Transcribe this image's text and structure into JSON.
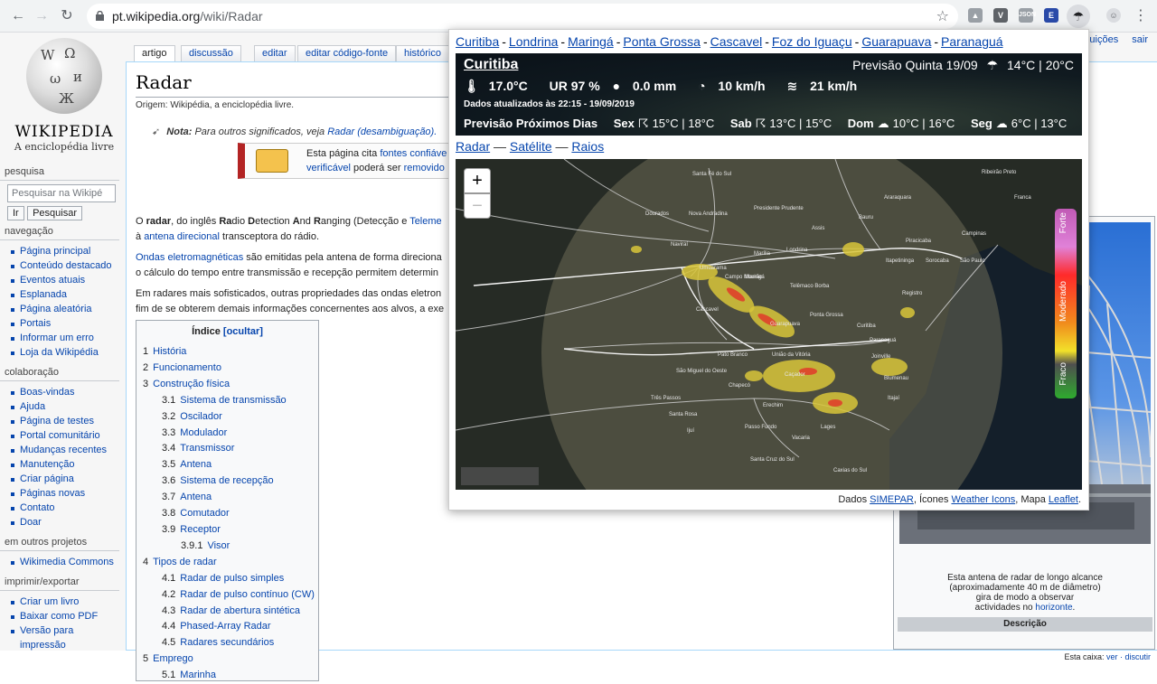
{
  "browser": {
    "url_host": "pt.wikipedia.org",
    "url_path": "/wiki/Radar"
  },
  "wiki": {
    "logo_wordmark": "WIKIPEDIA",
    "logo_tagline": "A enciclopédia livre",
    "tabs": [
      "artigo",
      "discussão",
      "editar",
      "editar código-fonte",
      "histórico"
    ],
    "personal_links": [
      "uições",
      "sair"
    ],
    "title": "Radar",
    "site_sub": "Origem: Wikipédia, a enciclopédia livre.",
    "hatnote_prefix": "Nota:",
    "hatnote_text": "Para outros significados, veja",
    "hatnote_link": "Radar (desambiguação).",
    "ambox_line1_text": "Esta página cita",
    "ambox_line1_link": "fontes confiáve",
    "ambox_line2_link": "verificável",
    "ambox_line2_text": "poderá ser",
    "ambox_line2_link2": "removido",
    "search": {
      "heading": "pesquisa",
      "placeholder": "Pesquisar na Wikipé",
      "go": "Ir",
      "search": "Pesquisar"
    },
    "navigation": {
      "heading": "navegação",
      "items": [
        "Página principal",
        "Conteúdo destacado",
        "Eventos atuais",
        "Esplanada",
        "Página aleatória",
        "Portais",
        "Informar um erro",
        "Loja da Wikipédia"
      ]
    },
    "collaboration": {
      "heading": "colaboração",
      "items": [
        "Boas-vindas",
        "Ajuda",
        "Página de testes",
        "Portal comunitário",
        "Mudanças recentes",
        "Manutenção",
        "Criar página",
        "Páginas novas",
        "Contato",
        "Doar"
      ]
    },
    "other_projects": {
      "heading": "em outros projetos",
      "items": [
        "Wikimedia Commons"
      ]
    },
    "print_export": {
      "heading": "imprimir/exportar",
      "items": [
        "Criar um livro",
        "Baixar como PDF",
        "Versão para",
        "impressão"
      ]
    },
    "paragraphs": [
      {
        "pre": "O ",
        "b1": "radar",
        "t1": ", do inglês ",
        "b2": "Ra",
        "t2": "dio ",
        "b3": "D",
        "t3": "etection ",
        "b4": "A",
        "t4": "nd ",
        "b5": "R",
        "t5": "anging (Detecção e ",
        "link": "Teleme"
      },
      {
        "link_a": "antena direcional",
        "pre": "à ",
        "post": " transceptora do rádio."
      },
      {
        "link": "Ondas eletromagnéticas",
        "text": " são emitidas pela antena de forma direciona"
      },
      {
        "text": "o cálculo do tempo entre transmissão e recepção permitem determin"
      },
      {
        "text": "Em radares mais sofisticados, outras propriedades das ondas eletron"
      },
      {
        "text": "fim de se obterem demais informações concernentes aos alvos, a exe"
      }
    ],
    "toc": {
      "title": "Índice",
      "toggle": "[ocultar]",
      "items": [
        {
          "num": "1",
          "text": "História",
          "level": 1
        },
        {
          "num": "2",
          "text": "Funcionamento",
          "level": 1
        },
        {
          "num": "3",
          "text": "Construção física",
          "level": 1
        },
        {
          "num": "3.1",
          "text": "Sistema de transmissão",
          "level": 2
        },
        {
          "num": "3.2",
          "text": "Oscilador",
          "level": 2
        },
        {
          "num": "3.3",
          "text": "Modulador",
          "level": 2
        },
        {
          "num": "3.4",
          "text": "Transmissor",
          "level": 2
        },
        {
          "num": "3.5",
          "text": "Antena",
          "level": 2
        },
        {
          "num": "3.6",
          "text": "Sistema de recepção",
          "level": 2
        },
        {
          "num": "3.7",
          "text": "Antena",
          "level": 2
        },
        {
          "num": "3.8",
          "text": "Comutador",
          "level": 2
        },
        {
          "num": "3.9",
          "text": "Receptor",
          "level": 2
        },
        {
          "num": "3.9.1",
          "text": "Visor",
          "level": 3
        },
        {
          "num": "4",
          "text": "Tipos de radar",
          "level": 1
        },
        {
          "num": "4.1",
          "text": "Radar de pulso simples",
          "level": 2
        },
        {
          "num": "4.2",
          "text": "Radar de pulso contínuo (CW)",
          "level": 2
        },
        {
          "num": "4.3",
          "text": "Radar de abertura sintética",
          "level": 2
        },
        {
          "num": "4.4",
          "text": "Phased-Array Radar",
          "level": 2
        },
        {
          "num": "4.5",
          "text": "Radares secundários",
          "level": 2
        },
        {
          "num": "5",
          "text": "Emprego",
          "level": 1
        },
        {
          "num": "5.1",
          "text": "Marinha",
          "level": 2
        }
      ]
    },
    "infobox": {
      "caption_line1": "Esta antena de radar de longo alcance",
      "caption_line2": "(aproximadamente 40 m de diâmetro)",
      "caption_line3": "gira de modo a observar",
      "caption_line4_text": "actividades no",
      "caption_line4_link": "horizonte",
      "caption_line4_end": ".",
      "description_label": "Descrição",
      "edit_prefix": "Esta caixa:",
      "edit_links": "ver · discutir"
    }
  },
  "popup": {
    "cities": [
      "Curitiba",
      "Londrina",
      "Maringá",
      "Ponta Grossa",
      "Cascavel",
      "Foz do Iguaçu",
      "Guarapuava",
      "Paranaguá"
    ],
    "city_separator": "-",
    "weather": {
      "city": "Curitiba",
      "forecast_label": "Previsão Quinta 19/09",
      "forecast_temps": "14°C | 20°C",
      "temperature": "17.0°C",
      "humidity": "UR 97 %",
      "rain": "0.0 mm",
      "wind": "10 km/h",
      "gust": "21 km/h",
      "updated": "Dados atualizados às 22:15 - 19/09/2019",
      "next_days_label": "Previsão Próximos Dias",
      "next_days": [
        {
          "day": "Sex",
          "temps": "15°C | 18°C"
        },
        {
          "day": "Sab",
          "temps": "13°C | 15°C"
        },
        {
          "day": "Dom",
          "temps": "10°C | 16°C"
        },
        {
          "day": "Seg",
          "temps": "6°C | 13°C"
        }
      ]
    },
    "view_links": [
      "Radar",
      "Satélite",
      "Raios"
    ],
    "view_separator": "—",
    "map": {
      "zoom_in": "+",
      "zoom_out": "−",
      "legend": [
        "Forte",
        "Moderado",
        "Fraco"
      ],
      "city_labels": [
        "Ribeirão Preto",
        "Santa Fé do Sul",
        "Araraquara",
        "Franca",
        "Dourados",
        "Nova Andradina",
        "Presidente Prudente",
        "Bauru",
        "Naviraí",
        "Assis",
        "Marília",
        "Piracicaba",
        "Campinas",
        "Umuarama",
        "Maringá",
        "Londrina",
        "Sorocaba",
        "Itapetininga",
        "São Paulo",
        "Campo Mourão",
        "Telêmaco Borba",
        "Cascavel",
        "Ponta Grossa",
        "Registro",
        "Guarapuava",
        "Curitiba",
        "Paranaguá",
        "Pato Branco",
        "União da Vitória",
        "Joinville",
        "São Miguel do Oeste",
        "Chapecó",
        "Caçador",
        "Blumenau",
        "Itajaí",
        "Três Passos",
        "Erechim",
        "Santa Rosa",
        "Passo Fundo",
        "Lages",
        "Ijuí",
        "Vacaria",
        "Santa Cruz do Sul",
        "Caxias do Sul"
      ]
    },
    "credit_text1": "Dados",
    "credit_link1": "SIMEPAR",
    "credit_text2": ", Ícones",
    "credit_link2": "Weather Icons",
    "credit_text3": ", Mapa",
    "credit_link3": "Leaflet",
    "credit_end": "."
  }
}
